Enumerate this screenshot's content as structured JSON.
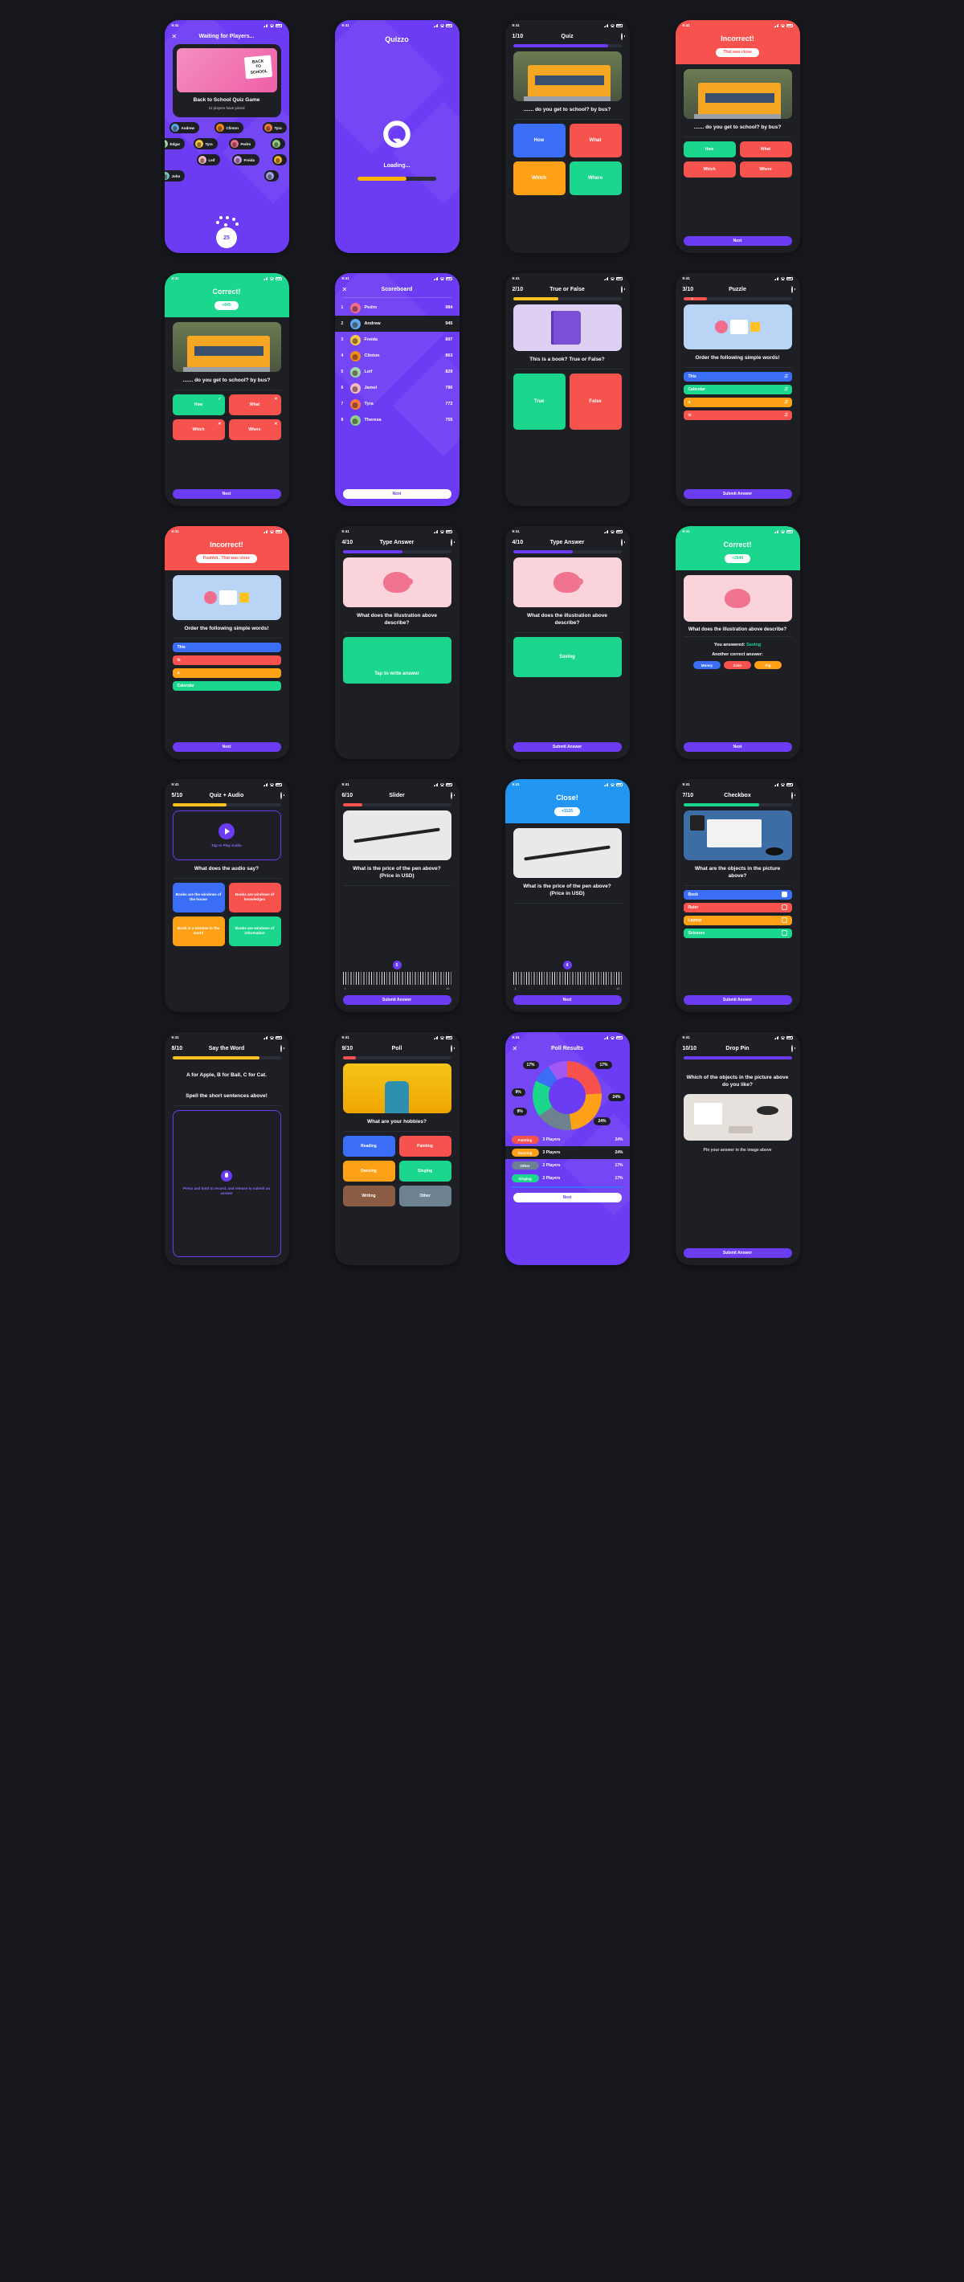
{
  "meta": {
    "status_time": "9:41",
    "app_name": "Quizzo"
  },
  "screens": [
    {
      "id": "waiting",
      "title": "Waiting for Players...",
      "close_icon": "close-icon",
      "game": {
        "name": "Back to School Quiz Game",
        "players_joined": "12 players have joined",
        "thumb_text": [
          "BACK",
          "TO",
          "SCHOOL"
        ]
      },
      "players": [
        "Andrew",
        "Clinton",
        "Tyra",
        "Pedro",
        "Edgar",
        "Leif",
        "Freida",
        "John"
      ],
      "count": "25"
    },
    {
      "id": "splash",
      "brand": "Quizzo",
      "loading_label": "Loading...",
      "progress_pct": 62
    },
    {
      "id": "quiz-1",
      "counter": "1/10",
      "title": "Quiz",
      "progress_pct": 88,
      "progress_color": "#6c3cf4",
      "question": "....... do you get to school?\nby bus?",
      "answers": [
        {
          "label": "How",
          "color": "#3b6ef6"
        },
        {
          "label": "What",
          "color": "#f8524f"
        },
        {
          "label": "Which",
          "color": "#ffa117"
        },
        {
          "label": "Where",
          "color": "#1bd68d"
        }
      ]
    },
    {
      "id": "incorrect-1",
      "banner_title": "Incorrect!",
      "banner_pill": "That was close",
      "banner_color": "#f8524f",
      "question": "....... do you get to school?\nby bus?",
      "answers": [
        {
          "label": "How",
          "color": "#1bd68d"
        },
        {
          "label": "What",
          "color": "#f8524f"
        },
        {
          "label": "Which",
          "color": "#f8524f"
        },
        {
          "label": "Where",
          "color": "#f8524f"
        }
      ],
      "next_label": "Next"
    },
    {
      "id": "correct-1",
      "banner_title": "Correct!",
      "banner_pill": "+845",
      "banner_color": "#1bd68d",
      "question": "....... do you get to school?\nby bus?",
      "answers": [
        {
          "label": "How",
          "color": "#1bd68d",
          "mark": "check"
        },
        {
          "label": "What",
          "color": "#f8524f",
          "mark": "cross"
        },
        {
          "label": "Which",
          "color": "#f8524f",
          "mark": "cross"
        },
        {
          "label": "Where",
          "color": "#f8524f",
          "mark": "cross"
        }
      ],
      "next_label": "Next"
    },
    {
      "id": "scoreboard",
      "title": "Scoreboard",
      "close_icon": "close-icon",
      "rows": [
        {
          "rank": "1",
          "name": "Pedro",
          "score": "984",
          "color": "#f06d8e",
          "highlight": false
        },
        {
          "rank": "2",
          "name": "Andrew",
          "score": "945",
          "color": "#5aa9f0",
          "highlight": true
        },
        {
          "rank": "3",
          "name": "Freida",
          "score": "897",
          "color": "#f6c945",
          "highlight": false
        },
        {
          "rank": "4",
          "name": "Clinton",
          "score": "863",
          "color": "#f58a18",
          "highlight": false
        },
        {
          "rank": "5",
          "name": "Leif",
          "score": "829",
          "color": "#9fd8a8",
          "highlight": false
        },
        {
          "rank": "6",
          "name": "Jamel",
          "score": "786",
          "color": "#f4b8c4",
          "highlight": false
        },
        {
          "rank": "7",
          "name": "Tyra",
          "score": "772",
          "color": "#f57a3c",
          "highlight": false
        },
        {
          "rank": "8",
          "name": "Theresa",
          "score": "755",
          "color": "#8cd18a",
          "highlight": false
        }
      ],
      "next_label": "Next"
    },
    {
      "id": "true-false",
      "counter": "2/10",
      "title": "True or False",
      "progress_pct": 42,
      "progress_color": "#ffc220",
      "question": "This is a book?\nTrue or False?",
      "answers": [
        {
          "label": "True",
          "color": "#1bd68d"
        },
        {
          "label": "False",
          "color": "#f8524f"
        }
      ]
    },
    {
      "id": "puzzle",
      "counter": "3/10",
      "title": "Puzzle",
      "progress_pct": 22,
      "progress_color": "#f8524f",
      "progress_label": "3",
      "question": "Order the following simple words!",
      "words": [
        {
          "label": "This",
          "color": "#3b6ef6"
        },
        {
          "label": "Calendar",
          "color": "#1bd68d"
        },
        {
          "label": "a",
          "color": "#ffa117"
        },
        {
          "label": "is",
          "color": "#f8524f"
        }
      ],
      "submit_label": "Submit Answer"
    },
    {
      "id": "incorrect-2",
      "banner_title": "Incorrect!",
      "banner_pill": "Fuuhhh.. That was close",
      "banner_color": "#f8524f",
      "question": "Order the following simple words!",
      "words": [
        {
          "label": "This",
          "color": "#3b6ef6"
        },
        {
          "label": "is",
          "color": "#f8524f"
        },
        {
          "label": "a",
          "color": "#ffa117"
        },
        {
          "label": "Calendar",
          "color": "#1bd68d"
        }
      ],
      "next_label": "Next"
    },
    {
      "id": "type-answer-empty",
      "counter": "4/10",
      "title": "Type Answer",
      "progress_pct": 55,
      "progress_color": "#6c3cf4",
      "question": "What does the illustration above describe?",
      "input_placeholder": "Tap to write answer"
    },
    {
      "id": "type-answer-filled",
      "counter": "4/10",
      "title": "Type Answer",
      "progress_pct": 55,
      "progress_color": "#6c3cf4",
      "question": "What does the illustration above describe?",
      "input_value": "Saving",
      "submit_label": "Submit Answer"
    },
    {
      "id": "correct-2",
      "banner_title": "Correct!",
      "banner_pill": "+2649",
      "banner_color": "#1bd68d",
      "question": "What does the illustration above describe?",
      "answered_label": "You answered:",
      "answered_value": "Saving",
      "another_label": "Another correct answer:",
      "alternatives": [
        {
          "label": "Money",
          "color": "#3b6ef6"
        },
        {
          "label": "Coin",
          "color": "#f8524f"
        },
        {
          "label": "Pig",
          "color": "#ffa117"
        }
      ],
      "next_label": "Next"
    },
    {
      "id": "quiz-audio",
      "counter": "5/10",
      "title": "Quiz + Audio",
      "progress_pct": 50,
      "progress_color": "#ffc220",
      "audio_label": "Tap to Play Audio",
      "question": "What does the audio say?",
      "answers": [
        {
          "label": "Books are the windows of the house",
          "color": "#3b6ef6"
        },
        {
          "label": "Books are windows of knowledges",
          "color": "#f8524f"
        },
        {
          "label": "Book is a window to the world",
          "color": "#ffa117"
        },
        {
          "label": "Books are windows of information",
          "color": "#1bd68d"
        }
      ]
    },
    {
      "id": "slider",
      "counter": "6/10",
      "title": "Slider",
      "progress_pct": 18,
      "progress_color": "#f8524f",
      "question": "What is the price of the pen above?\n(Price in USD)",
      "value": "5",
      "min": "1",
      "max": "10",
      "submit_label": "Submit Answer"
    },
    {
      "id": "close",
      "banner_title": "Close!",
      "banner_pill": "+3125",
      "banner_color": "#2196f3",
      "question": "What is the price of the pen above?\n(Price in USD)",
      "value": "4",
      "min": "1",
      "max": "10",
      "next_label": "Next"
    },
    {
      "id": "checkbox",
      "counter": "7/10",
      "title": "Checkbox",
      "progress_pct": 70,
      "progress_color": "#1bd68d",
      "question": "What are the objects in the picture above?",
      "options": [
        {
          "label": "Book",
          "color": "#3b6ef6",
          "checked": true
        },
        {
          "label": "Ruler",
          "color": "#f8524f",
          "checked": false
        },
        {
          "label": "Laptop",
          "color": "#ffa117",
          "checked": false
        },
        {
          "label": "Scissors",
          "color": "#1bd68d",
          "checked": false
        }
      ],
      "submit_label": "Submit Answer"
    },
    {
      "id": "say-the-word",
      "counter": "8/10",
      "title": "Say the Word",
      "progress_pct": 80,
      "progress_color": "#ffc220",
      "phrase": "A for Apple, B for Ball,\nC for Cat.",
      "question": "Spell the short sentences above!",
      "mic_hint": "Press and hold to record, and release to submit an answer"
    },
    {
      "id": "poll",
      "counter": "9/10",
      "title": "Poll",
      "progress_pct": 12,
      "progress_color": "#f8524f",
      "question": "What are your hobbies?",
      "options": [
        {
          "label": "Reading",
          "color": "#3b6ef6"
        },
        {
          "label": "Painting",
          "color": "#f8524f"
        },
        {
          "label": "Dancing",
          "color": "#ffa117"
        },
        {
          "label": "Singing",
          "color": "#1bd68d"
        },
        {
          "label": "Writing",
          "color": "#8a5c44"
        },
        {
          "label": "Other",
          "color": "#6c8290"
        }
      ]
    },
    {
      "id": "poll-results",
      "title": "Poll Results",
      "close_icon": "close-icon",
      "next_label": "Next",
      "chart_data": {
        "type": "pie",
        "title": "Poll Results",
        "labels": [
          "Painting",
          "Dancing",
          "Other",
          "Singing"
        ],
        "values": [
          24,
          24,
          17,
          17
        ],
        "players": [
          3,
          3,
          2,
          2
        ],
        "colors": [
          "#f8524f",
          "#ffa117",
          "#6c8290",
          "#1bd68d"
        ],
        "pct_labels": [
          "24%",
          "24%",
          "17%",
          "17%",
          "9%",
          "9%"
        ],
        "legend_position": "bottom",
        "rows": [
          {
            "label": "Painting",
            "color": "#f8524f",
            "players": "3 Players",
            "pct": "24%",
            "highlight": false
          },
          {
            "label": "Dancing",
            "color": "#ffa117",
            "players": "3 Players",
            "pct": "24%",
            "highlight": true
          },
          {
            "label": "Other",
            "color": "#6c8290",
            "players": "2 Players",
            "pct": "17%",
            "highlight": false
          },
          {
            "label": "Singing",
            "color": "#1bd68d",
            "players": "2 Players",
            "pct": "17%",
            "highlight": false
          }
        ]
      }
    },
    {
      "id": "drop-pin",
      "counter": "10/10",
      "title": "Drop Pin",
      "progress_pct": 100,
      "progress_color": "#6c3cf4",
      "question": "Which of the objects in the picture above do you like?",
      "hint": "Pin your answer in the image above",
      "submit_label": "Submit Answer"
    }
  ]
}
